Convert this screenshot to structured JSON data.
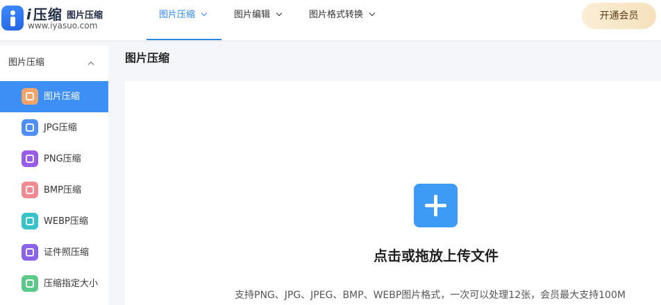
{
  "logo": {
    "mark": "i",
    "name": "压缩",
    "tagline": "图片压缩",
    "url": "www.iyasuo.com",
    "icon": "logo-i-icon"
  },
  "nav": {
    "items": [
      {
        "label": "图片压缩",
        "active": true
      },
      {
        "label": "图片编辑",
        "active": false
      },
      {
        "label": "图片格式转换",
        "active": false
      }
    ],
    "vip_button": "开通会员"
  },
  "sidebar": {
    "section_label": "图片压缩",
    "section_expanded": true,
    "items": [
      {
        "label": "图片压缩",
        "icon": "image-compress-icon",
        "color": "#f0a46a",
        "active": true
      },
      {
        "label": "JPG压缩",
        "icon": "jpg-file-icon",
        "color": "#4f8ef7",
        "active": false
      },
      {
        "label": "PNG压缩",
        "icon": "png-file-icon",
        "color": "#9a5be6",
        "active": false
      },
      {
        "label": "BMP压缩",
        "icon": "bmp-file-icon",
        "color": "#f08a93",
        "active": false
      },
      {
        "label": "WEBP压缩",
        "icon": "webp-file-icon",
        "color": "#36c2c9",
        "active": false
      },
      {
        "label": "证件照压缩",
        "icon": "id-photo-icon",
        "color": "#8a63e8",
        "active": false
      },
      {
        "label": "压缩指定大小",
        "icon": "kb-size-icon",
        "color": "#5cc98a",
        "active": false
      }
    ]
  },
  "main": {
    "title": "图片压缩",
    "upload": {
      "icon": "plus-icon",
      "title": "点击或拖放上传文件",
      "hint": "支持PNG、JPG、JPEG、BMP、WEBP图片格式，一次可以处理12张，会员最大支持100M"
    }
  },
  "colors": {
    "accent": "#2e86f1",
    "active_sidebar": "#3d8ef5",
    "upload_button": "#3d9bf5",
    "vip_gradient_start": "#fbeed6",
    "vip_gradient_end": "#f5e1bb"
  }
}
